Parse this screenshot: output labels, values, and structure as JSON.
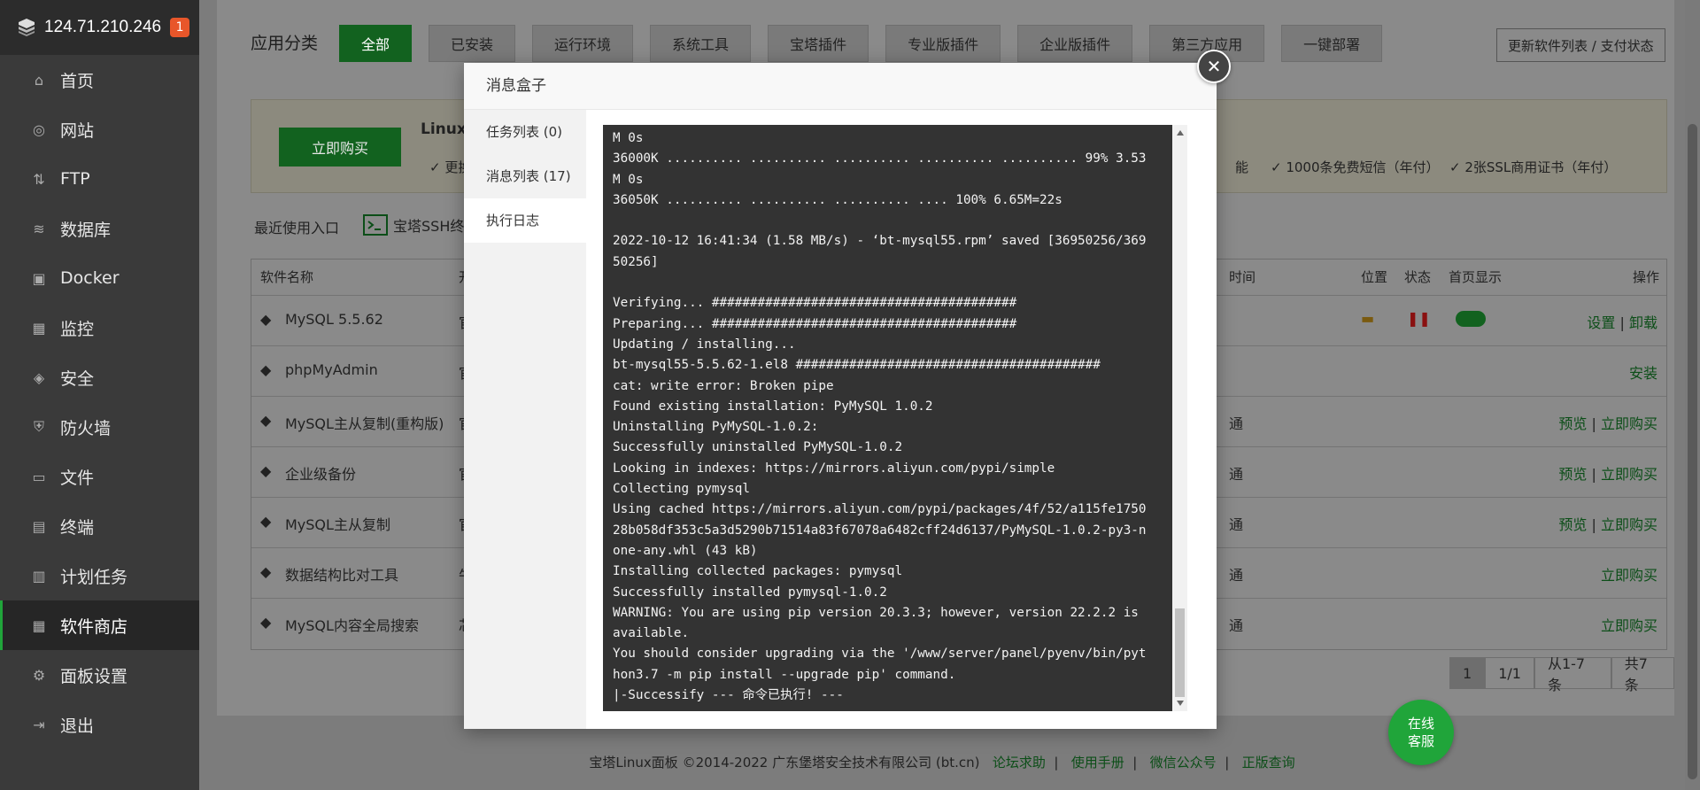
{
  "server": {
    "ip": "124.71.210.246",
    "badge": "1"
  },
  "sidebar": {
    "items": [
      {
        "label": "首页",
        "icon": "home-icon"
      },
      {
        "label": "网站",
        "icon": "globe-icon"
      },
      {
        "label": "FTP",
        "icon": "ftp-icon"
      },
      {
        "label": "数据库",
        "icon": "database-icon"
      },
      {
        "label": "Docker",
        "icon": "docker-icon"
      },
      {
        "label": "监控",
        "icon": "monitor-icon"
      },
      {
        "label": "安全",
        "icon": "shield-icon"
      },
      {
        "label": "防火墙",
        "icon": "firewall-icon"
      },
      {
        "label": "文件",
        "icon": "folder-icon"
      },
      {
        "label": "终端",
        "icon": "terminal-icon"
      },
      {
        "label": "计划任务",
        "icon": "calendar-icon"
      },
      {
        "label": "软件商店",
        "icon": "apps-icon",
        "active": true
      },
      {
        "label": "面板设置",
        "icon": "gear-icon"
      },
      {
        "label": "退出",
        "icon": "logout-icon"
      }
    ]
  },
  "store": {
    "category_label": "应用分类",
    "tabs": [
      "全部",
      "已安装",
      "运行环境",
      "系统工具",
      "宝塔插件",
      "专业版插件",
      "企业版插件",
      "第三方应用",
      "一键部署"
    ],
    "refresh_label": "更新软件列表 / 支付状态",
    "buy_label": "立即购买",
    "promo_title": "Linux",
    "promo_item1": "更换",
    "promo_item2": "能",
    "promo_item3": "1000条免费短信（年付）",
    "promo_item4": "2张SSL商用证书（年付）",
    "recent_label": "最近使用入口",
    "ssh_label": "宝塔SSH终端"
  },
  "table": {
    "headers": {
      "name": "软件名称",
      "dev": "开发",
      "time": "时间",
      "loc": "位置",
      "status": "状态",
      "home": "首页显示",
      "ops": "操作"
    },
    "rows": [
      {
        "name": "MySQL 5.5.62",
        "dev": "官方",
        "extra": "",
        "ops": [
          "设置",
          "卸载"
        ]
      },
      {
        "name": "phpMyAdmin",
        "dev": "官方",
        "extra": "",
        "ops": [
          "安装"
        ]
      },
      {
        "name": "MySQL主从复制(重构版)",
        "dev": "官方",
        "extra": "通",
        "ops": [
          "预览",
          "立即购买"
        ]
      },
      {
        "name": "企业级备份",
        "dev": "官方",
        "extra": "通",
        "ops": [
          "预览",
          "立即购买"
        ]
      },
      {
        "name": "MySQL主从复制",
        "dev": "官方",
        "extra": "通",
        "ops": [
          "预览",
          "立即购买"
        ]
      },
      {
        "name": "数据结构比对工具",
        "dev": "牛郎",
        "extra": "通",
        "ops": [
          "立即购买"
        ]
      },
      {
        "name": "MySQL内容全局搜索",
        "dev": "芯游",
        "extra": "通",
        "ops": [
          "立即购买"
        ]
      }
    ]
  },
  "pager": {
    "current": "1",
    "pages": "1/1",
    "range": "从1-7条",
    "total": "共7条"
  },
  "footer": {
    "copyright": "宝塔Linux面板 ©2014-2022 广东堡塔安全技术有限公司 (bt.cn)",
    "links": [
      "论坛求助",
      "使用手册",
      "微信公众号",
      "正版查询"
    ]
  },
  "chat": {
    "line1": "在线",
    "line2": "客服"
  },
  "modal": {
    "title": "消息盒子",
    "nav": [
      "任务列表 (0)",
      "消息列表 (17)",
      "执行日志"
    ],
    "log": "M 0s\n36000K .......... .......... .......... .......... .......... 99% 3.53\nM 0s\n36050K .......... .......... .......... .... 100% 6.65M=22s\n\n2022-10-12 16:41:34 (1.58 MB/s) - ‘bt-mysql55.rpm’ saved [36950256/369\n50256]\n\nVerifying... ########################################\nPreparing... ########################################\nUpdating / installing...\nbt-mysql55-5.5.62-1.el8 ########################################\ncat: write error: Broken pipe\nFound existing installation: PyMySQL 1.0.2\nUninstalling PyMySQL-1.0.2:\nSuccessfully uninstalled PyMySQL-1.0.2\nLooking in indexes: https://mirrors.aliyun.com/pypi/simple\nCollecting pymysql\nUsing cached https://mirrors.aliyun.com/pypi/packages/4f/52/a115fe1750\n28b058df353c5a3d5290b71514a83f67078a6482cff24d6137/PyMySQL-1.0.2-py3-n\none-any.whl (43 kB)\nInstalling collected packages: pymysql\nSuccessfully installed pymysql-1.0.2\nWARNING: You are using pip version 20.3.3; however, version 22.2.2 is\navailable.\nYou should consider upgrading via the '/www/server/panel/pyenv/bin/pyt\nhon3.7 -m pip install --upgrade pip' command.\n|-Successify --- 命令已执行! ---"
  },
  "colors": {
    "accent": "#20a53a",
    "sidebar": "#3a3a3a",
    "log_bg": "#333333"
  }
}
